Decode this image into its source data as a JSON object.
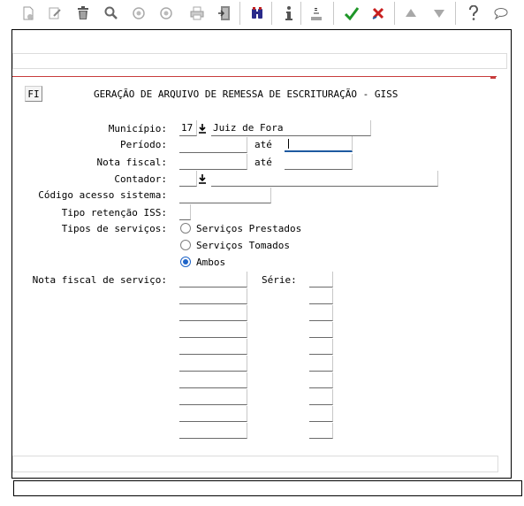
{
  "toolbar": {
    "buttons": [
      {
        "name": "new-document-icon"
      },
      {
        "name": "edit-pencil-icon"
      },
      {
        "name": "trash-icon"
      },
      {
        "name": "search-icon"
      },
      {
        "name": "previous-circle-icon"
      },
      {
        "name": "next-circle-icon"
      },
      {
        "name": "printer-icon"
      },
      {
        "name": "exit-door-icon"
      },
      {
        "name": "binoculars-icon"
      },
      {
        "name": "info-icon"
      },
      {
        "name": "list-numbered-icon"
      },
      {
        "name": "confirm-check-icon",
        "color": "#1e9628"
      },
      {
        "name": "cancel-x-icon",
        "color": "#c81e1e"
      },
      {
        "name": "up-arrow-icon"
      },
      {
        "name": "down-arrow-icon"
      },
      {
        "name": "help-question-icon"
      },
      {
        "name": "comment-bubble-icon"
      }
    ]
  },
  "header": {
    "fi_button": "FI",
    "title": "GERAÇÃO DE ARQUIVO DE REMESSA DE ESCRITURAÇÃO - GISS"
  },
  "form": {
    "municipio_label": "Município:",
    "municipio_code": "17",
    "municipio_name": "Juiz de Fora",
    "periodo_label": "Período:",
    "periodo_from": "",
    "periodo_ate": "até",
    "periodo_to": "",
    "nota_label": "Nota fiscal:",
    "nota_from": "",
    "nota_ate": "até",
    "nota_to": "",
    "contador_label": "Contador:",
    "contador_code": "",
    "contador_name": "",
    "codigo_label": "Código acesso sistema:",
    "codigo_value": "",
    "retencao_label": "Tipo retenção ISS:",
    "retencao_value": "",
    "tipos_label": "Tipos de serviços:",
    "tipos_options": [
      {
        "label": "Serviços Prestados",
        "selected": false
      },
      {
        "label": "Serviços Tomados",
        "selected": false
      },
      {
        "label": "Ambos",
        "selected": true
      }
    ],
    "nfs_label": "Nota fiscal de serviço:",
    "serie_label": "Série:",
    "nfs_rows": [
      "",
      "",
      "",
      "",
      "",
      "",
      "",
      "",
      "",
      ""
    ],
    "serie_rows": [
      "",
      "",
      "",
      "",
      "",
      "",
      "",
      "",
      "",
      ""
    ]
  },
  "colors": {
    "accent_blue": "#1e64c8",
    "separator_red": "#c83c3c"
  }
}
